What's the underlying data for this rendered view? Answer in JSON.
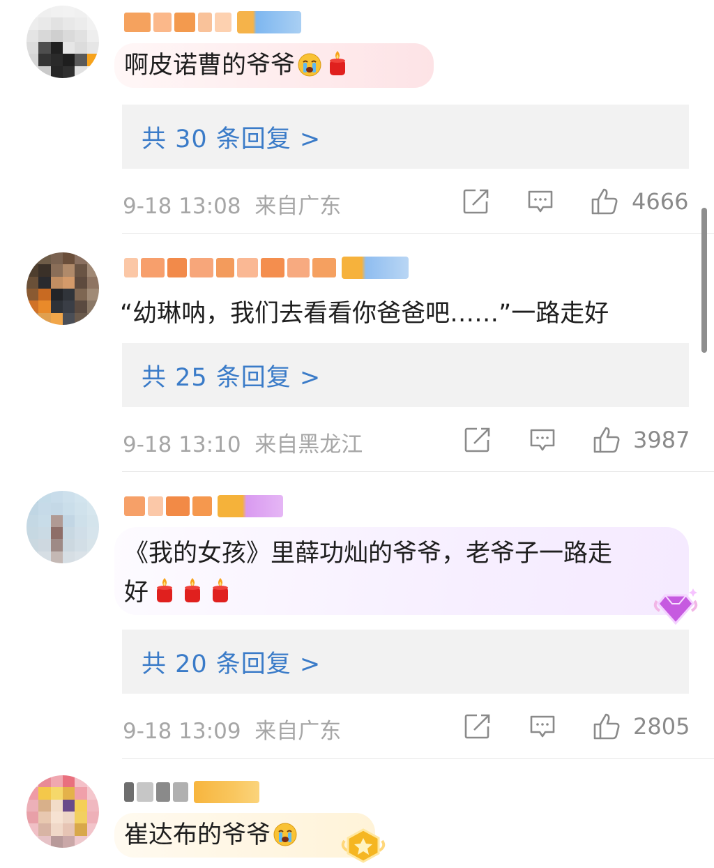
{
  "comments": [
    {
      "text": "啊皮诺曹的爷爷",
      "replies": "共 30 条回复 >",
      "time": "9-18 13:08",
      "location": "来自广东",
      "likes": "4666"
    },
    {
      "text": "“幼琳呐，我们去看看你爸爸吧……”一路走好",
      "replies": "共 25 条回复 >",
      "time": "9-18 13:10",
      "location": "来自黑龙江",
      "likes": "3987"
    },
    {
      "text_line1": "《我的女孩》里薛功灿的爷爷，老爷子一路走",
      "text_line2": "好",
      "replies": "共 20 条回复 >",
      "time": "9-18 13:09",
      "location": "来自广东",
      "likes": "2805"
    },
    {
      "text": "崔达布的爷爷"
    }
  ],
  "icons": {
    "share": "share-icon",
    "comment": "comment-icon",
    "like": "thumbs-up-icon",
    "cry": "crying-face-emoji",
    "candle": "candle-emoji",
    "gem": "vip-gem-badge"
  },
  "colors": {
    "reply_link": "#3a7bc8",
    "meta_text": "#a6a6a6",
    "reply_bg": "#f2f2f2"
  }
}
